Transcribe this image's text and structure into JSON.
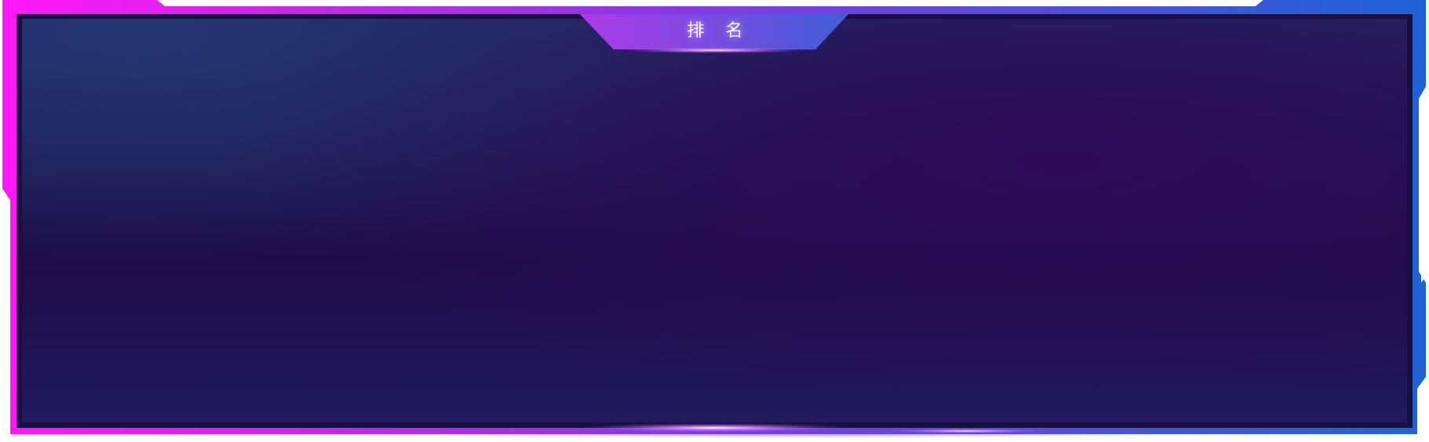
{
  "panel": {
    "title": "排 名"
  },
  "colors": {
    "frame_gradient_start": "#ff18f5",
    "frame_gradient_end": "#1e63d6",
    "panel_dark": "#1e0c48",
    "panel_purple": "#2a0c55",
    "panel_blue": "#23306b",
    "glow": "#c87cff"
  }
}
